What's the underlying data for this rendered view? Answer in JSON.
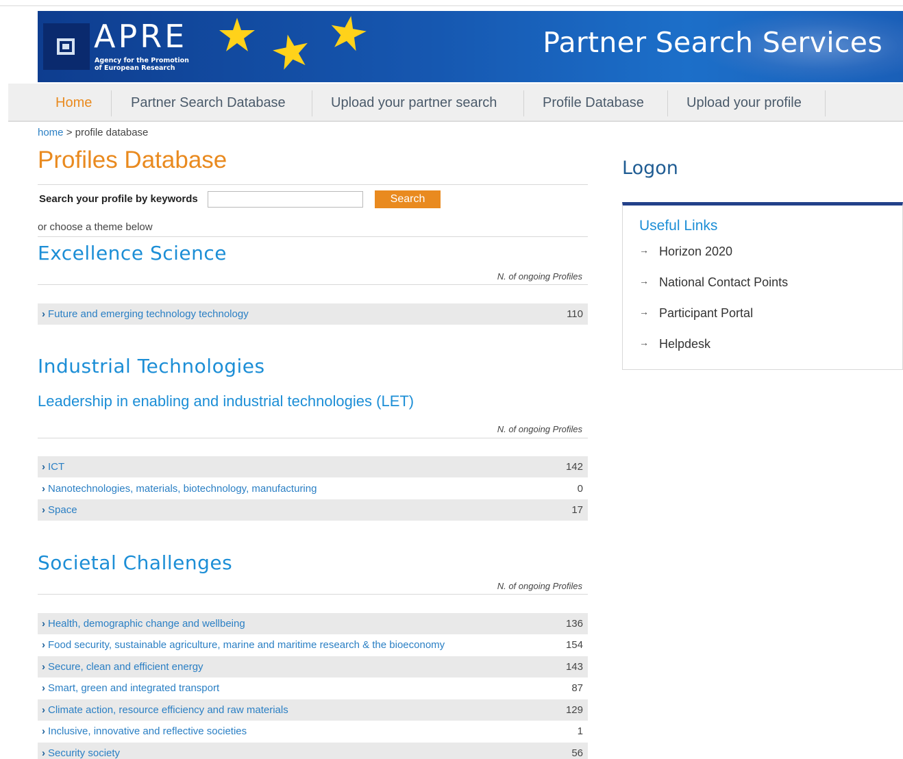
{
  "banner": {
    "logo_text": "APRE",
    "logo_sub_1": "Agency for the Promotion",
    "logo_sub_2": "of European Research",
    "title": "Partner Search Services"
  },
  "nav": {
    "items": [
      {
        "label": "Home",
        "active": true
      },
      {
        "label": "Partner Search Database"
      },
      {
        "label": "Upload your partner search"
      },
      {
        "label": "Profile Database"
      },
      {
        "label": "Upload your profile"
      }
    ]
  },
  "breadcrumb": {
    "home": "home",
    "sep": " > ",
    "current": "profile database"
  },
  "page": {
    "title": "Profiles Database",
    "search_label": "Search your profile by keywords",
    "search_value": "",
    "search_button": "Search",
    "choose_text": "or choose a theme below",
    "col_head": "N. of ongoing Profiles"
  },
  "sections": [
    {
      "title": "Excellence Science",
      "rows": [
        {
          "label": "Future and emerging technology technology",
          "count": "110"
        }
      ]
    },
    {
      "title": "Industrial Technologies",
      "subtitle": "Leadership in enabling and industrial technologies (LET)",
      "rows": [
        {
          "label": "ICT",
          "count": "142"
        },
        {
          "label": "Nanotechnologies, materials, biotechnology, manufacturing",
          "count": "0"
        },
        {
          "label": "Space",
          "count": "17"
        }
      ]
    },
    {
      "title": "Societal Challenges",
      "rows": [
        {
          "label": "Health, demographic change and wellbeing",
          "count": "136"
        },
        {
          "label": "Food security, sustainable agriculture, marine and maritime research & the bioeconomy",
          "count": "154"
        },
        {
          "label": "Secure, clean and efficient energy",
          "count": "143"
        },
        {
          "label": "Smart, green and integrated transport",
          "count": "87"
        },
        {
          "label": "Climate action, resource efficiency and raw materials",
          "count": "129"
        },
        {
          "label": "Inclusive, innovative and reflective societies",
          "count": "1"
        },
        {
          "label": "Security society",
          "count": "56"
        }
      ]
    }
  ],
  "sidebar": {
    "logon": "Logon",
    "useful_links_title": "Useful Links",
    "links": [
      "Horizon 2020",
      "National Contact Points",
      "Participant Portal",
      "Helpdesk"
    ]
  },
  "colors": {
    "accent_orange": "#e98a1f",
    "link_blue": "#1c8ed6",
    "banner_blue": "#1657b0"
  }
}
